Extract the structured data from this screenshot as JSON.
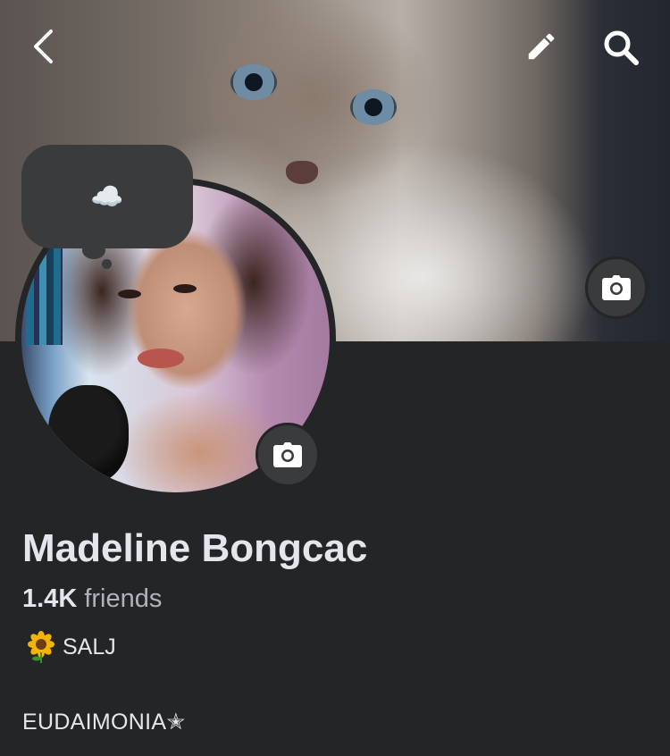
{
  "header": {
    "back_icon": "chevron-left-icon",
    "edit_icon": "pencil-icon",
    "search_icon": "search-icon"
  },
  "cover": {
    "image": "cover-photo-white-kitten",
    "camera_icon": "camera-icon"
  },
  "profile": {
    "image": "profile-photo",
    "camera_icon": "camera-icon",
    "note_icon": "cloud-icon",
    "note_text": "☁️",
    "name": "Madeline Bongcac",
    "friends_count": "1.4K",
    "friends_label": "friends",
    "bio_line1_emoji": "sunflower-icon",
    "bio_line1_text": "SALJ",
    "bio_line2": "EUDAIMONIA✭"
  },
  "colors": {
    "background": "#242526",
    "text_primary": "#e4e6eb",
    "text_secondary": "#b0b3b8",
    "button_bg": "#3a3b3c"
  }
}
